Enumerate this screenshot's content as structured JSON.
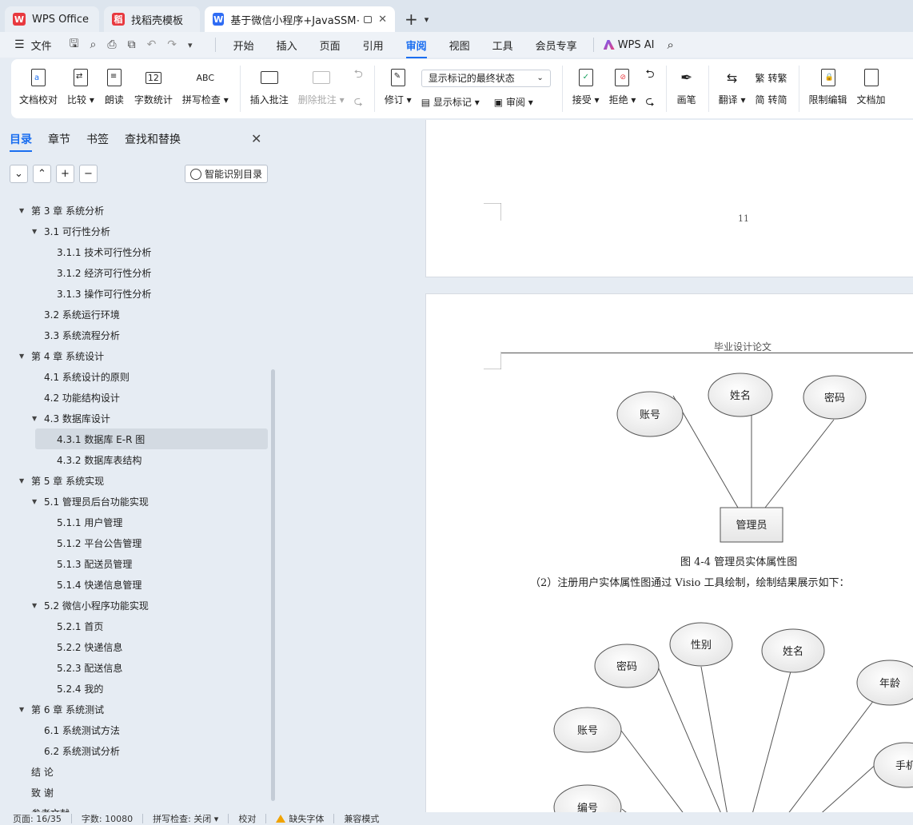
{
  "tabs": [
    {
      "label": "WPS Office",
      "logo": "W",
      "logo_color": "#e8393f",
      "active": false
    },
    {
      "label": "找稻壳模板",
      "logo": "稻",
      "logo_color": "#e8393f",
      "active": false
    },
    {
      "label": "基于微信小程序+JavaSSM+M",
      "logo": "W",
      "logo_color": "#2f6cf4",
      "active": true
    }
  ],
  "menu": {
    "file": "文件",
    "items": [
      "开始",
      "插入",
      "页面",
      "引用",
      "审阅",
      "视图",
      "工具",
      "会员专享"
    ],
    "active": "审阅",
    "ai_label": "WPS AI"
  },
  "ribbon": {
    "doc_proof": "文档校对",
    "compare": "比较",
    "read_aloud": "朗读",
    "word_count": "字数统计",
    "spell_check": "拼写检查",
    "spell_icon_text": "ABC",
    "count_icon_text": "12",
    "insert_comment": "插入批注",
    "delete_comment": "删除批注",
    "revise": "修订",
    "markup_state": "显示标记的最终状态",
    "show_markup": "显示标记",
    "review": "审阅",
    "accept": "接受",
    "reject": "拒绝",
    "pen": "画笔",
    "translate": "翻译",
    "to_traditional": "转繁",
    "to_simplified": "转简",
    "traditional_icon": "繁",
    "simplified_icon": "简",
    "restrict_edit": "限制编辑",
    "doc_encrypt": "文档加"
  },
  "nav": {
    "tabs": [
      "目录",
      "章节",
      "书签",
      "查找和替换"
    ],
    "active_tab": "目录",
    "smart_toc": "智能识别目录",
    "toc": [
      {
        "level": 1,
        "label": "第 3 章  系统分析",
        "toggle": true
      },
      {
        "level": 2,
        "label": "3.1 可行性分析",
        "toggle": true
      },
      {
        "level": 3,
        "label": "3.1.1 技术可行性分析"
      },
      {
        "level": 3,
        "label": "3.1.2 经济可行性分析"
      },
      {
        "level": 3,
        "label": "3.1.3 操作可行性分析"
      },
      {
        "level": 2,
        "label": "3.2 系统运行环境"
      },
      {
        "level": 2,
        "label": "3.3 系统流程分析"
      },
      {
        "level": 1,
        "label": "第 4 章  系统设计",
        "toggle": true
      },
      {
        "level": 2,
        "label": "4.1  系统设计的原则"
      },
      {
        "level": 2,
        "label": "4.2  功能结构设计"
      },
      {
        "level": 2,
        "label": "4.3  数据库设计",
        "toggle": true
      },
      {
        "level": 3,
        "label": "4.3.1  数据库 E-R 图",
        "selected": true
      },
      {
        "level": 3,
        "label": "4.3.2  数据库表结构"
      },
      {
        "level": 1,
        "label": "第 5 章  系统实现",
        "toggle": true
      },
      {
        "level": 2,
        "label": "5.1 管理员后台功能实现",
        "toggle": true
      },
      {
        "level": 3,
        "label": "5.1.1  用户管理"
      },
      {
        "level": 3,
        "label": "5.1.2  平台公告管理"
      },
      {
        "level": 3,
        "label": "5.1.3  配送员管理"
      },
      {
        "level": 3,
        "label": "5.1.4  快递信息管理"
      },
      {
        "level": 2,
        "label": "5.2  微信小程序功能实现",
        "toggle": true
      },
      {
        "level": 3,
        "label": "5.2.1  首页"
      },
      {
        "level": 3,
        "label": "5.2.2  快递信息"
      },
      {
        "level": 3,
        "label": "5.2.3  配送信息"
      },
      {
        "level": 3,
        "label": "5.2.4  我的"
      },
      {
        "level": 1,
        "label": "第 6 章  系统测试",
        "toggle": true
      },
      {
        "level": 2,
        "label": "6.1 系统测试方法"
      },
      {
        "level": 2,
        "label": "6.2  系统测试分析"
      },
      {
        "level": 1,
        "label": "结    论"
      },
      {
        "level": 1,
        "label": "致    谢"
      },
      {
        "level": 1,
        "label": "参考文献"
      }
    ]
  },
  "document": {
    "page_number": "11",
    "header": "毕业设计论文",
    "figure1": {
      "entity": "管理员",
      "attributes": [
        "账号",
        "姓名",
        "密码"
      ],
      "caption": "图 4-4 管理员实体属性图"
    },
    "paragraph": "（2）注册用户实体属性图通过 Visio 工具绘制，绘制结果展示如下：",
    "figure2": {
      "attributes": [
        "密码",
        "性别",
        "姓名",
        "年龄",
        "账号",
        "手机",
        "编号"
      ]
    }
  },
  "status": {
    "page": "页面: 16/35",
    "words": "字数: 10080",
    "spell": "拼写检查: 关闭",
    "proof": "校对",
    "missing_font": "缺失字体",
    "compat": "兼容模式"
  },
  "colors": {
    "accent": "#1a6ef0",
    "wps_red": "#e8393f",
    "warning": "#f0a300"
  }
}
